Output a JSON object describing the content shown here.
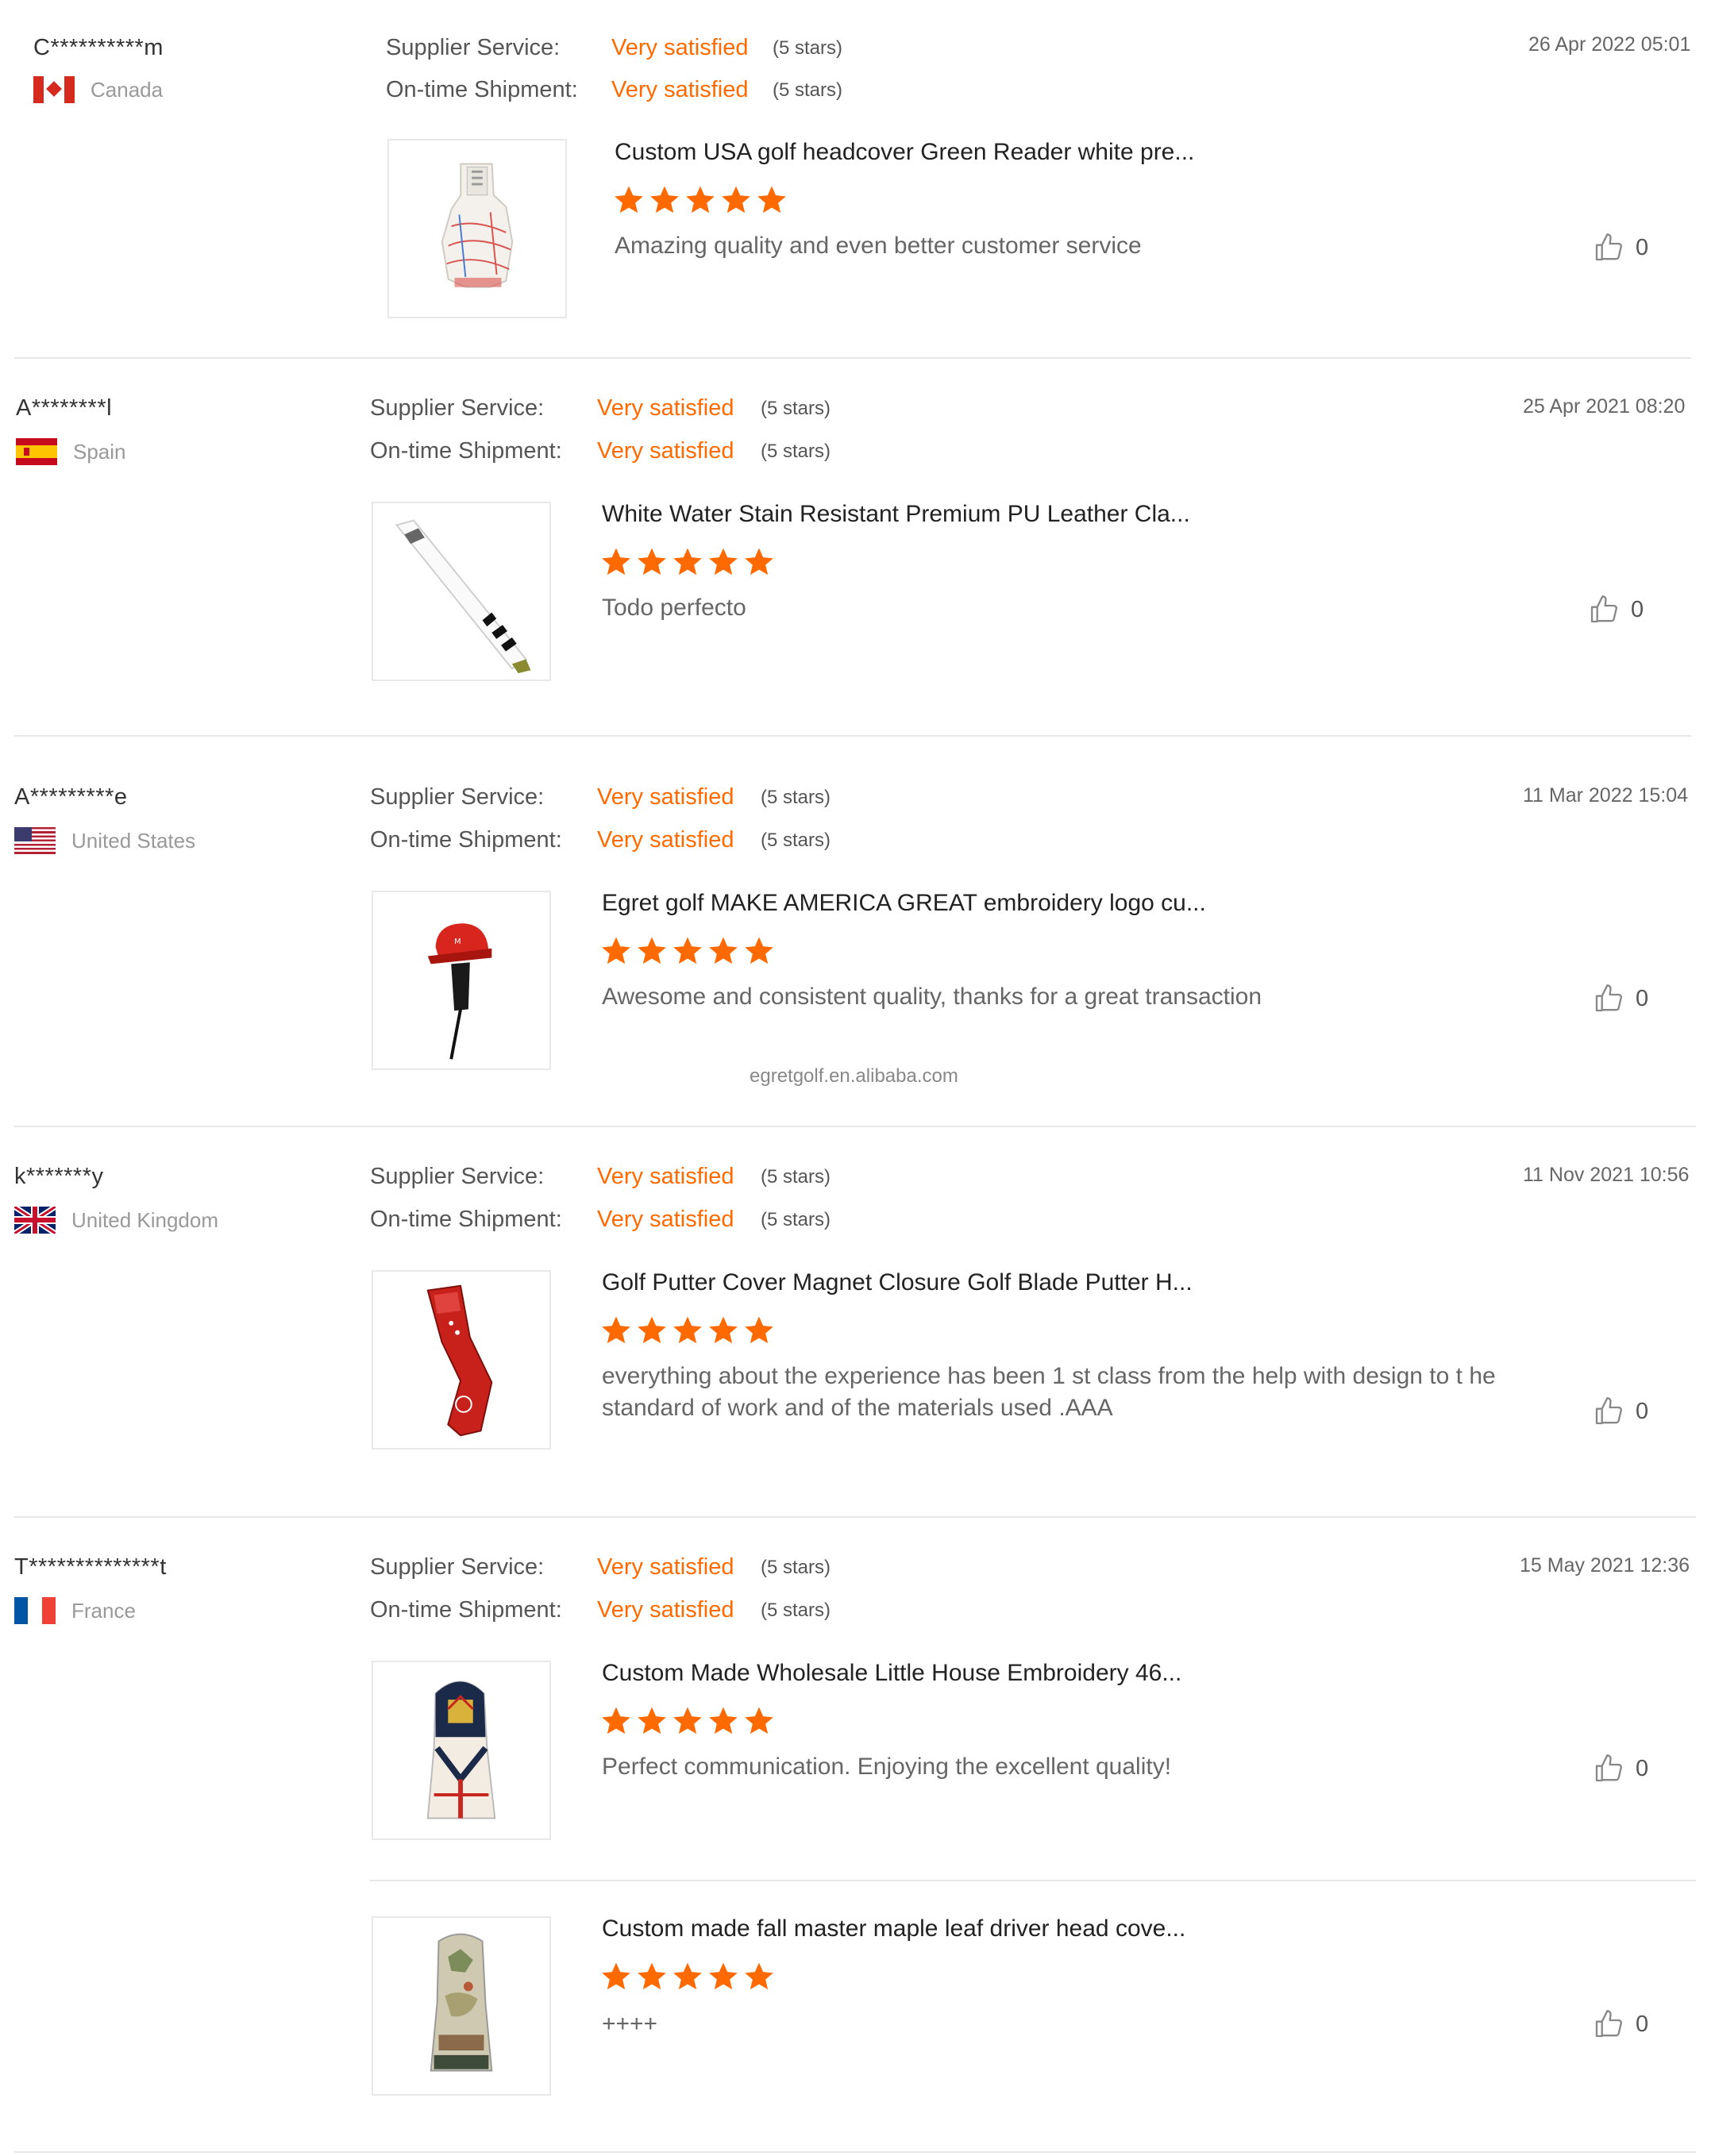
{
  "labels": {
    "supplier_service": "Supplier Service:",
    "ontime_shipment": "On-time Shipment:"
  },
  "colors": {
    "accent": "#ff6a00",
    "star": "#ff6a00",
    "text": "#333333",
    "muted": "#999999"
  },
  "watermark": "egretgolf.en.alibaba.com",
  "reviews": [
    {
      "user": "C**********m",
      "country": "Canada",
      "flag": "canada-flag-icon",
      "supplier_value": "Very satisfied",
      "supplier_stars": "(5 stars)",
      "shipment_value": "Very satisfied",
      "shipment_stars": "(5 stars)",
      "date": "26 Apr 2022 05:01",
      "products": [
        {
          "title": "Custom USA golf headcover Green Reader white pre...",
          "rating": 5,
          "comment": "Amazing quality and even better customer service",
          "likes": "0",
          "image": "green-reader-headcover-image"
        }
      ]
    },
    {
      "user": "A********l",
      "country": "Spain",
      "flag": "spain-flag-icon",
      "supplier_value": "Very satisfied",
      "supplier_stars": "(5 stars)",
      "shipment_value": "Very satisfied",
      "shipment_stars": "(5 stars)",
      "date": "25 Apr 2021 08:20",
      "products": [
        {
          "title": "White Water Stain Resistant Premium PU Leather Cla...",
          "rating": 5,
          "comment": "Todo perfecto",
          "likes": "0",
          "image": "white-club-cover-image"
        }
      ]
    },
    {
      "user": "A*********e",
      "country": "United States",
      "flag": "usa-flag-icon",
      "supplier_value": "Very satisfied",
      "supplier_stars": "(5 stars)",
      "shipment_value": "Very satisfied",
      "shipment_stars": "(5 stars)",
      "date": "11 Mar 2022 15:04",
      "products": [
        {
          "title": "Egret golf MAKE AMERICA GREAT embroidery logo cu...",
          "rating": 5,
          "comment": "Awesome and consistent quality, thanks for a great transaction",
          "likes": "0",
          "image": "red-cap-headcover-image"
        }
      ]
    },
    {
      "user": "k*******y",
      "country": "United Kingdom",
      "flag": "uk-flag-icon",
      "supplier_value": "Very satisfied",
      "supplier_stars": "(5 stars)",
      "shipment_value": "Very satisfied",
      "shipment_stars": "(5 stars)",
      "date": "11 Nov 2021 10:56",
      "products": [
        {
          "title": "Golf Putter Cover Magnet Closure Golf Blade Putter H...",
          "rating": 5,
          "comment": "everything about the experience has been 1 st class from the help with design to t he standard of work and of the materials used .AAA",
          "likes": "0",
          "image": "red-putter-cover-image"
        }
      ]
    },
    {
      "user": "T**************t",
      "country": "France",
      "flag": "france-flag-icon",
      "supplier_value": "Very satisfied",
      "supplier_stars": "(5 stars)",
      "shipment_value": "Very satisfied",
      "shipment_stars": "(5 stars)",
      "date": "15 May 2021 12:36",
      "products": [
        {
          "title": "Custom Made Wholesale Little House Embroidery 46...",
          "rating": 5,
          "comment": "Perfect communication. Enjoying the excellent quality!",
          "likes": "0",
          "image": "little-house-headcover-image"
        },
        {
          "title": "Custom made fall master maple leaf driver head cove...",
          "rating": 5,
          "comment": "++++",
          "likes": "0",
          "image": "maple-leaf-headcover-image"
        }
      ]
    }
  ]
}
